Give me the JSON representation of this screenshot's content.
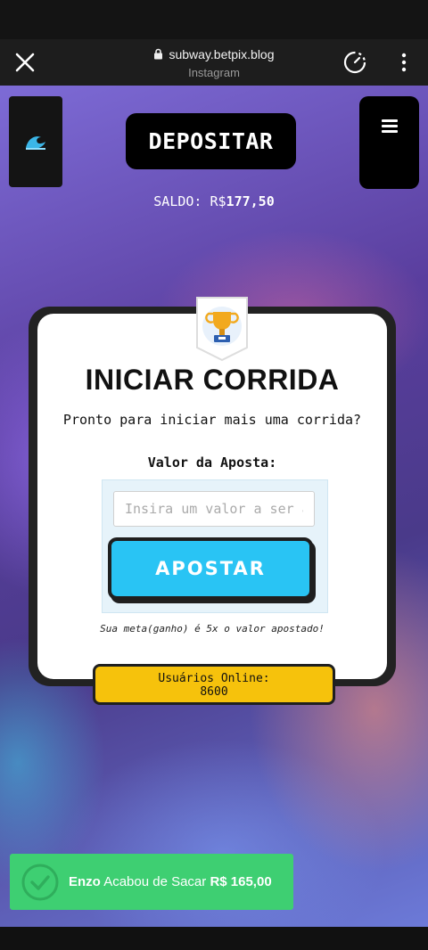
{
  "browser": {
    "domain": "subway.betpix.blog",
    "source": "Instagram"
  },
  "header": {
    "deposit_label": "DEPOSITAR",
    "balance_label": "SALDO:",
    "balance_currency": "R$",
    "balance_value": "177,50"
  },
  "card": {
    "title": "INICIAR CORRIDA",
    "subtitle": "Pronto para iniciar mais uma corrida?",
    "bet_label": "Valor da Aposta:",
    "bet_input": {
      "placeholder": "Insira um valor a ser apostado",
      "value": ""
    },
    "bet_button": "APOSTAR",
    "goal_note": "Sua meta(ganho) é 5x o valor apostado!"
  },
  "online": {
    "label": "Usuários Online:",
    "count": "8600"
  },
  "toast": {
    "name": "Enzo",
    "action": "Acabou de Sacar",
    "amount": "R$ 165,00"
  },
  "colors": {
    "accent_blue": "#29c4f4",
    "online_yellow": "#f6c20c",
    "toast_green": "#3ecf72"
  },
  "icons": [
    "close-icon",
    "lock-icon",
    "timer-icon",
    "more-vert-icon",
    "wave-logo-icon",
    "hamburger-menu-icon",
    "trophy-icon",
    "check-circle-icon"
  ]
}
